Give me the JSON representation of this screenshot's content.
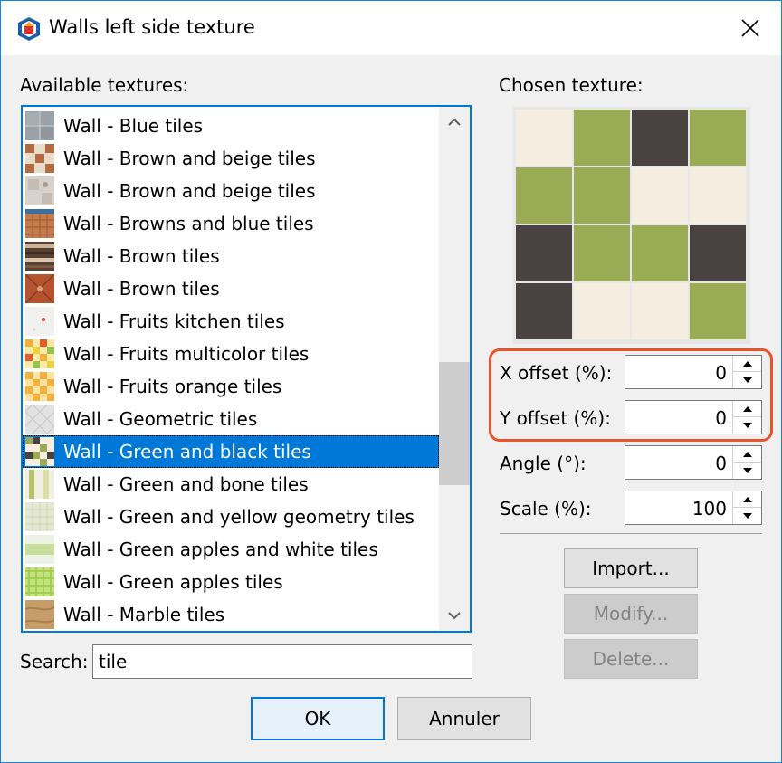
{
  "window": {
    "title": "Walls left side texture",
    "app_icon": "sweet-home-3d-icon",
    "close_icon": "close-icon"
  },
  "available_label": "Available textures:",
  "chosen_label": "Chosen texture:",
  "textures": [
    {
      "label": "Wall - Blue tiles",
      "thumb": "blue"
    },
    {
      "label": "Wall - Brown and beige tiles",
      "thumb": "brownbeige1"
    },
    {
      "label": "Wall - Brown and beige tiles",
      "thumb": "brownbeige2"
    },
    {
      "label": "Wall - Browns and blue tiles",
      "thumb": "brownsblue"
    },
    {
      "label": "Wall - Brown tiles",
      "thumb": "brown1"
    },
    {
      "label": "Wall - Brown tiles",
      "thumb": "brown2"
    },
    {
      "label": "Wall - Fruits kitchen tiles",
      "thumb": "fruitskitchen"
    },
    {
      "label": "Wall - Fruits multicolor tiles",
      "thumb": "fruitsmulti"
    },
    {
      "label": "Wall - Fruits orange tiles",
      "thumb": "fruitsorange"
    },
    {
      "label": "Wall - Geometric tiles",
      "thumb": "geometric"
    },
    {
      "label": "Wall - Green and black tiles",
      "thumb": "greenblack",
      "selected": true
    },
    {
      "label": "Wall - Green and bone tiles",
      "thumb": "greenbone"
    },
    {
      "label": "Wall - Green and yellow geometry tiles",
      "thumb": "greenyellow"
    },
    {
      "label": "Wall - Green apples and white tiles",
      "thumb": "applewhite"
    },
    {
      "label": "Wall - Green apples tiles",
      "thumb": "apples"
    },
    {
      "label": "Wall - Marble tiles",
      "thumb": "marble"
    }
  ],
  "fields": {
    "x_offset": {
      "label": "X offset (%):",
      "value": "0"
    },
    "y_offset": {
      "label": "Y offset (%):",
      "value": "0"
    },
    "angle": {
      "label": "Angle (°):",
      "value": "0"
    },
    "scale": {
      "label": "Scale (%):",
      "value": "100"
    }
  },
  "buttons": {
    "import": "Import...",
    "modify": "Modify...",
    "delete": "Delete...",
    "ok": "OK",
    "cancel": "Annuler"
  },
  "search": {
    "label": "Search:",
    "value": "tile"
  },
  "colors": {
    "accent": "#0078d7",
    "highlight": "#e8532a",
    "tile_cream": "#f5ede0",
    "tile_green": "#9aaa55",
    "tile_dark": "#4a4240"
  },
  "preview_grid": [
    [
      "c",
      "g",
      "d",
      "g"
    ],
    [
      "g",
      "g",
      "c",
      "c"
    ],
    [
      "d",
      "g",
      "g",
      "d"
    ],
    [
      "d",
      "c",
      "c",
      "g"
    ]
  ]
}
